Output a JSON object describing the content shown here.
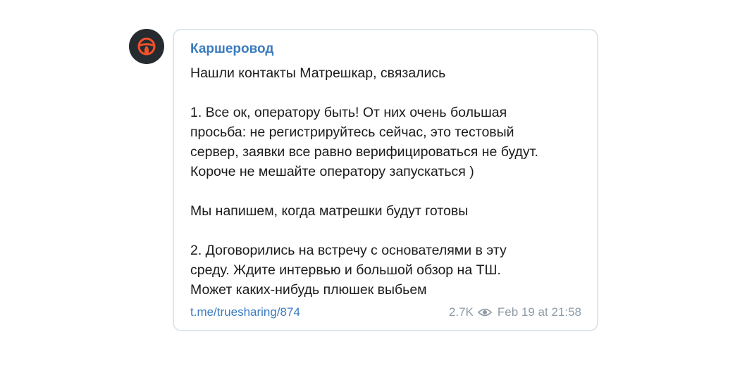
{
  "post": {
    "author": "Каршеровод",
    "avatar_icon": "steering-wheel-icon",
    "avatar_bg": "#262b30",
    "avatar_accent": "#f0522b",
    "lines": [
      "Нашли контакты Матрешкар, связались",
      "",
      "1. Все ок, оператору быть! От них очень большая",
      "просьба: не регистрируйтесь сейчас, это тестовый",
      "сервер, заявки все равно верифицироваться не будут.",
      "Короче не мешайте оператору запускаться )",
      "",
      "Мы напишем, когда матрешки будут готовы",
      "",
      "2. Договорились на встречу с основателями в эту",
      "среду. Ждите интервью и большой обзор на ТШ.",
      "Может каких-нибудь плюшек выбьем"
    ],
    "link": "t.me/truesharing/874",
    "views": "2.7K",
    "views_icon": "eye-icon",
    "timestamp": "Feb 19 at 21:58"
  }
}
